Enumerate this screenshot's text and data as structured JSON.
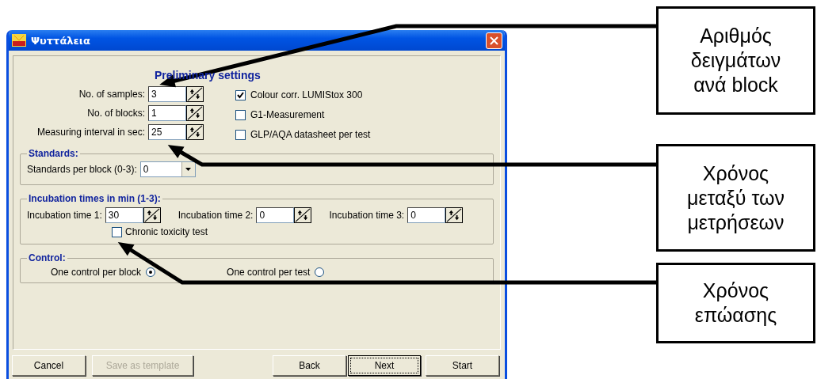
{
  "window": {
    "title": "Ψυττάλεια"
  },
  "heading": "Preliminary settings",
  "fields": [
    {
      "label": "No. of samples:",
      "value": "3"
    },
    {
      "label": "No. of blocks:",
      "value": "1"
    },
    {
      "label": "Measuring interval in sec:",
      "value": "25"
    }
  ],
  "options": [
    {
      "label": "Colour corr. LUMIStox 300",
      "checked": true
    },
    {
      "label": "G1-Measurement",
      "checked": false
    },
    {
      "label": "GLP/AQA datasheet per test",
      "checked": false
    }
  ],
  "standards": {
    "title": "Standards:",
    "label": "Standards per block (0-3):",
    "value": "0"
  },
  "incubation": {
    "title": "Incubation times in min (1-3):",
    "times": [
      {
        "label": "Incubation time 1:",
        "value": "30"
      },
      {
        "label": "Incubation time 2:",
        "value": "0"
      },
      {
        "label": "Incubation time 3:",
        "value": "0"
      }
    ],
    "chronic": {
      "label": "Chronic toxicity test",
      "checked": false
    }
  },
  "control": {
    "title": "Control:",
    "options": [
      {
        "label": "One control per block",
        "selected": true
      },
      {
        "label": "One control per test",
        "selected": false
      }
    ]
  },
  "buttons": [
    {
      "label": "Cancel",
      "disabled": false,
      "default": false
    },
    {
      "label": "Save as template",
      "disabled": true,
      "default": false
    },
    {
      "label": "Back",
      "disabled": false,
      "default": false
    },
    {
      "label": "Next",
      "disabled": false,
      "default": true
    },
    {
      "label": "Start",
      "disabled": false,
      "default": false
    }
  ],
  "callouts": [
    {
      "text": "Αριθμός\nδειγμάτων\nανά block"
    },
    {
      "text": "Χρόνος\nμεταξύ των\nμετρήσεων"
    },
    {
      "text": "Χρόνος\nεπώασης"
    }
  ]
}
